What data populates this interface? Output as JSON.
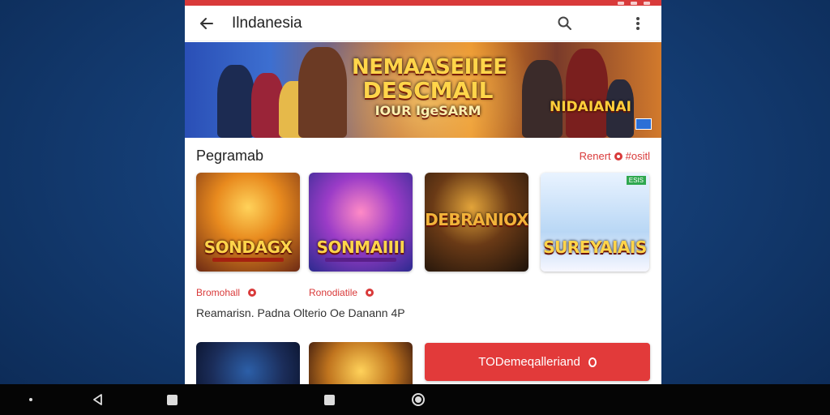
{
  "appbar": {
    "title": "Ilndanesia",
    "back_icon": "arrow-back-icon",
    "search_icon": "search-icon",
    "more_icon": "more-vert-icon"
  },
  "banner": {
    "headline_line1": "NEMAASEIIEE",
    "headline_line2": "DESCMAIL",
    "headline_line3": "IOUR IgeSARM",
    "side_brand": "NIDAIANAI"
  },
  "section": {
    "title": "Pegramab",
    "link_label": "Renert"
  },
  "tiles": [
    {
      "name": "SONDAGX"
    },
    {
      "name": "SONMAIIII"
    },
    {
      "name": "DEBRANIOX"
    },
    {
      "name": "SUREYAIAIS",
      "badge": "ESIS"
    }
  ],
  "meta": [
    {
      "label": "Bromohall"
    },
    {
      "label": "Ronodiatile"
    }
  ],
  "description": "Reamarisn. Padna Olterio Oe Danann 4P",
  "cta": {
    "label": "TODemeqalleriand"
  },
  "colors": {
    "accent": "#d93a3a",
    "cta": "#e23a3a",
    "background": "#143d74",
    "navbar": "#050505"
  }
}
